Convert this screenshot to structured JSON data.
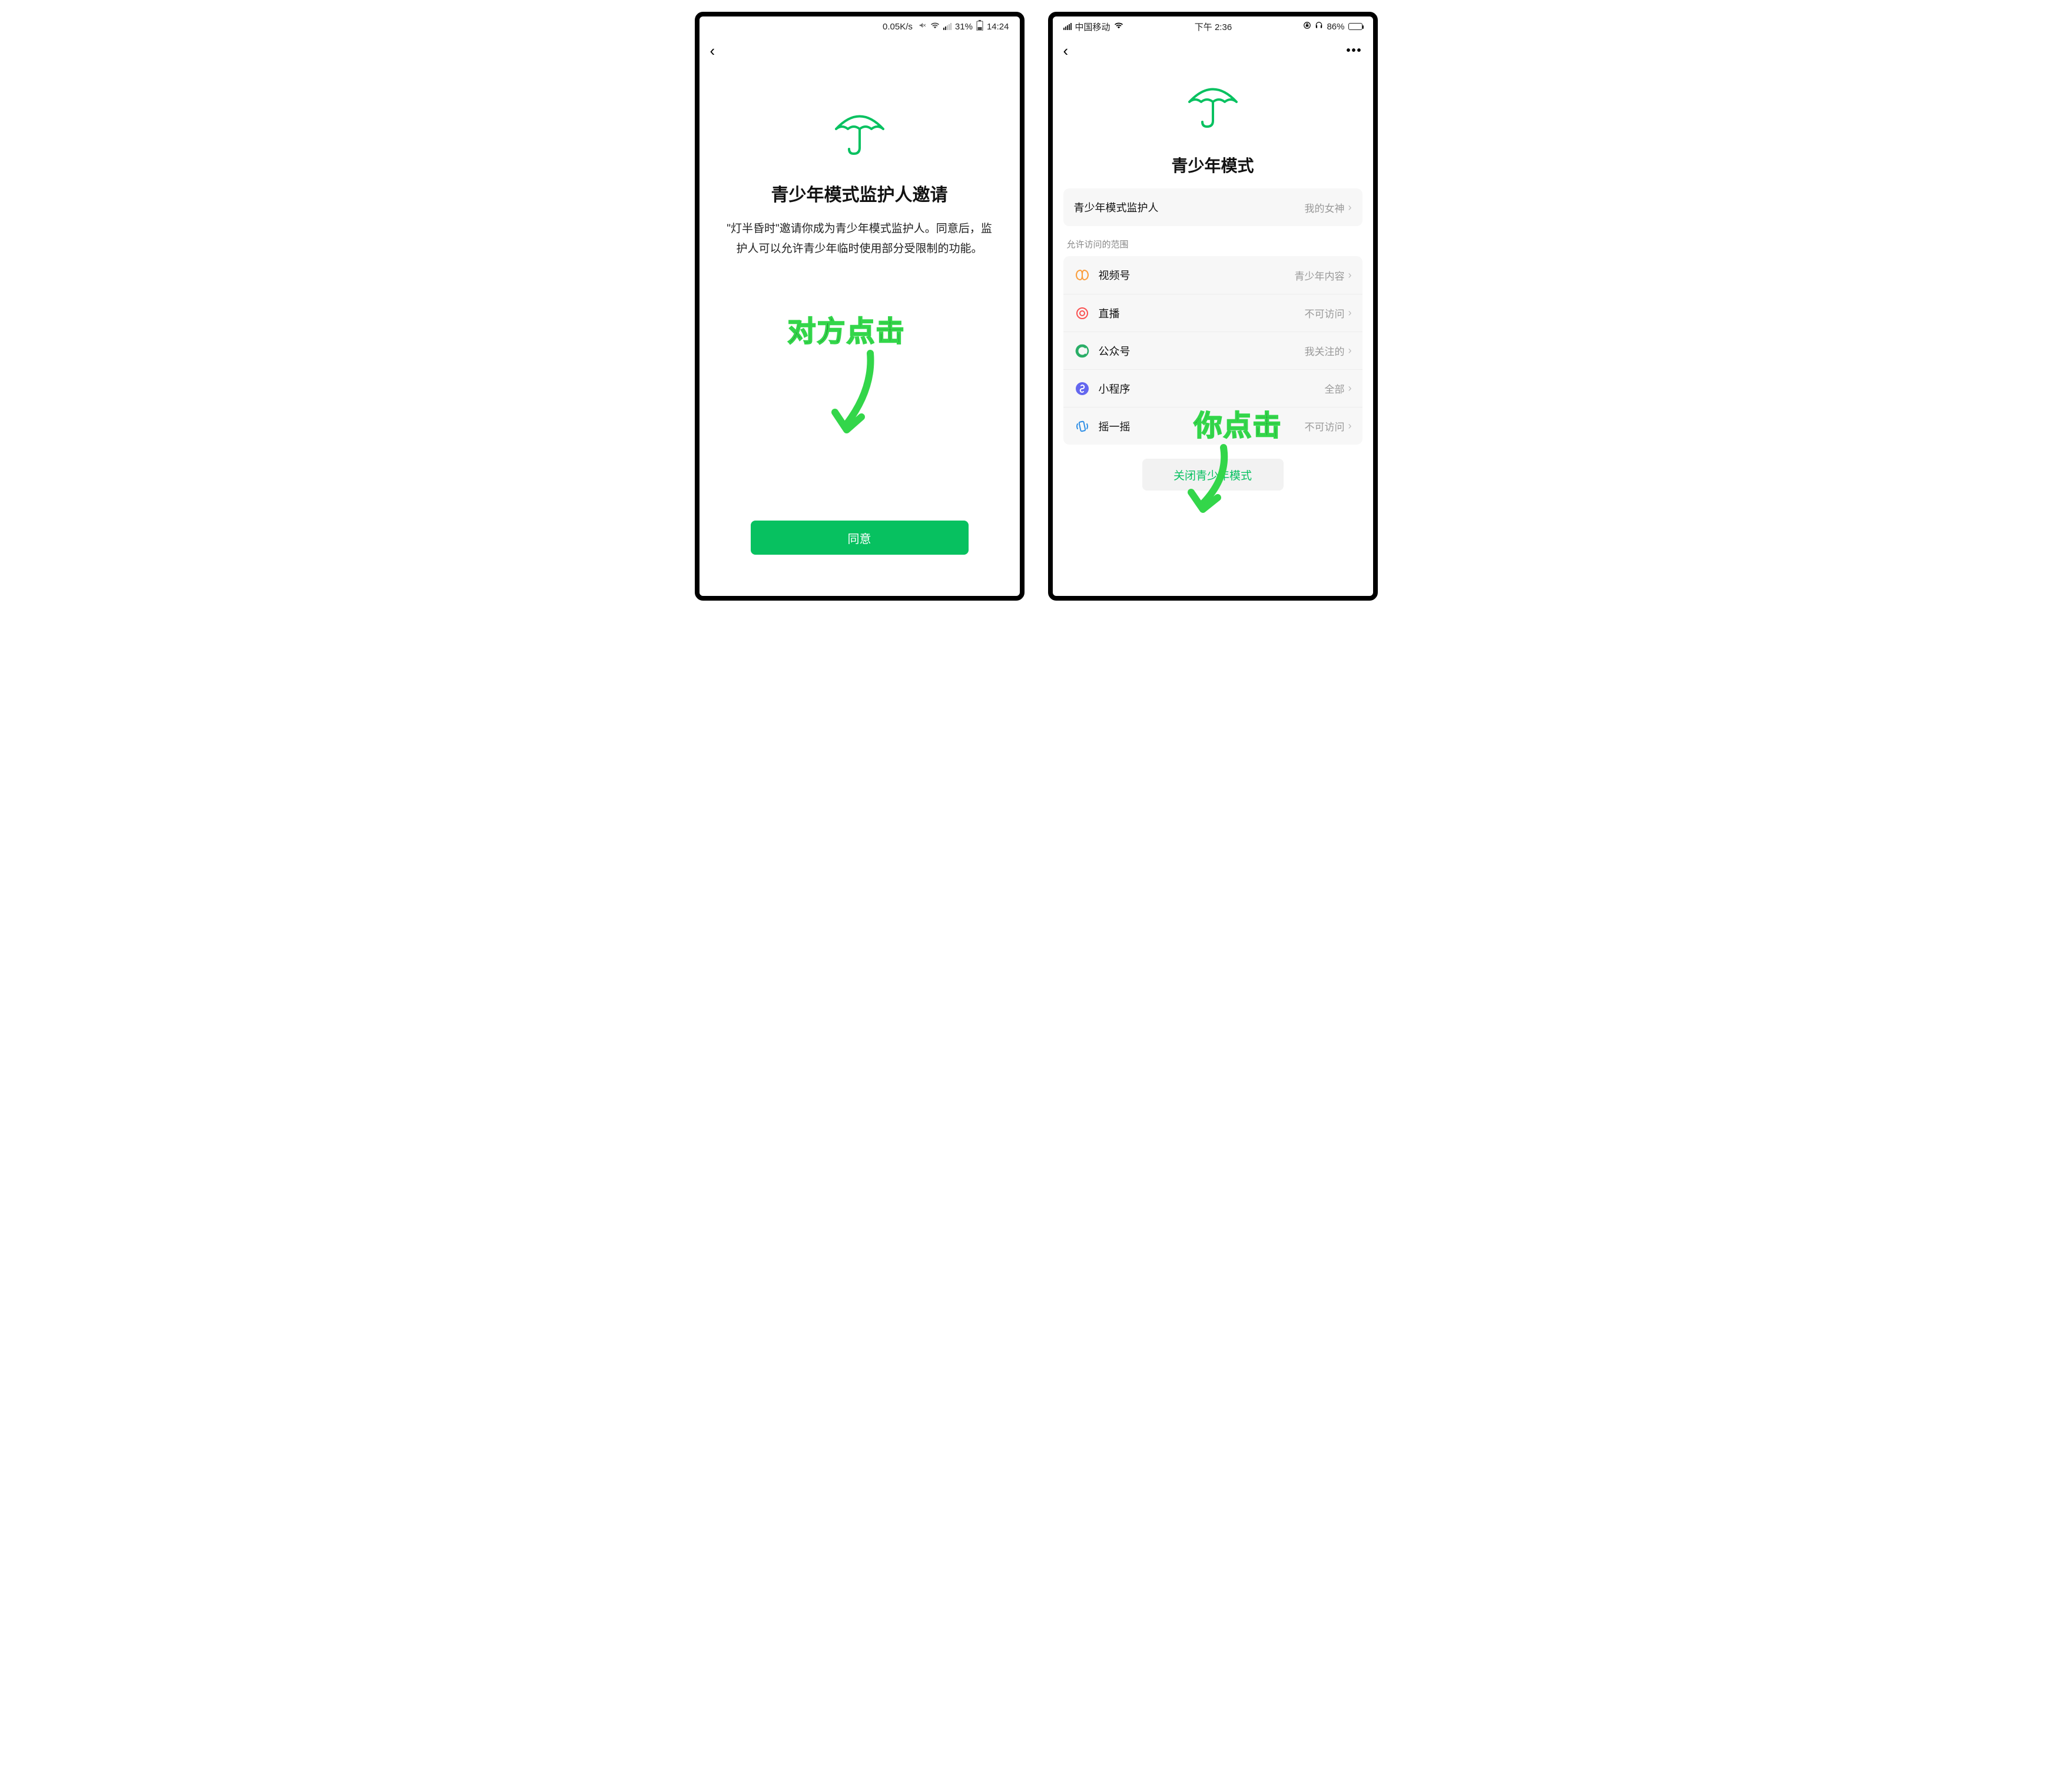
{
  "left_phone": {
    "statusbar": {
      "speed": "0.05K/s",
      "battery_pct": "31%",
      "time": "14:24"
    },
    "title": "青少年模式监护人邀请",
    "description": "\"灯半昏时\"邀请你成为青少年模式监护人。同意后，监护人可以允许青少年临时使用部分受限制的功能。",
    "agree_label": "同意",
    "annotation": "对方点击"
  },
  "right_phone": {
    "statusbar": {
      "carrier": "中国移动",
      "time": "下午 2:36",
      "battery_pct": "86%"
    },
    "title": "青少年模式",
    "guardian_row": {
      "label": "青少年模式监护人",
      "value": "我的女神"
    },
    "scope_header": "允许访问的范围",
    "rows": [
      {
        "icon": "channels",
        "label": "视频号",
        "value": "青少年内容"
      },
      {
        "icon": "live",
        "label": "直播",
        "value": "不可访问"
      },
      {
        "icon": "official",
        "label": "公众号",
        "value": "我关注的"
      },
      {
        "icon": "mini",
        "label": "小程序",
        "value": "全部"
      },
      {
        "icon": "shake",
        "label": "摇一摇",
        "value": "不可访问"
      }
    ],
    "close_label": "关闭青少年模式",
    "annotation": "你点击"
  },
  "colors": {
    "accent": "#07c160"
  }
}
